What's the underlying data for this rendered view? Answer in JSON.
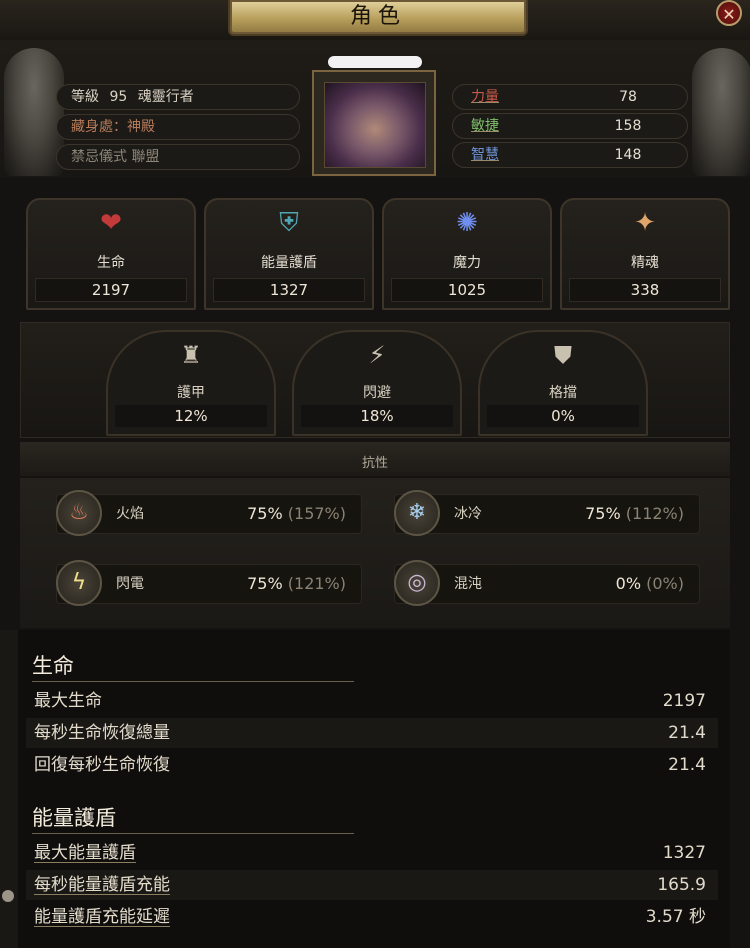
{
  "window": {
    "title": "角色",
    "close_label": "✕"
  },
  "character": {
    "name_redacted": "",
    "level_label": "等級",
    "level": "95",
    "class": "魂靈行者",
    "hideout": "藏身處：神殿",
    "league": "禁忌儀式 聯盟"
  },
  "attributes": [
    {
      "label": "力量",
      "value": "78"
    },
    {
      "label": "敏捷",
      "value": "158"
    },
    {
      "label": "智慧",
      "value": "148"
    }
  ],
  "resources": [
    {
      "label": "生命",
      "value": "2197",
      "icon": "heart-icon"
    },
    {
      "label": "能量護盾",
      "value": "1327",
      "icon": "energy-shield-icon"
    },
    {
      "label": "魔力",
      "value": "1025",
      "icon": "mana-icon"
    },
    {
      "label": "精魂",
      "value": "338",
      "icon": "spirit-icon"
    }
  ],
  "defenses": [
    {
      "label": "護甲",
      "value": "12%",
      "icon": "armour-icon"
    },
    {
      "label": "閃避",
      "value": "18%",
      "icon": "evasion-icon"
    },
    {
      "label": "格擋",
      "value": "0%",
      "icon": "block-shield-icon"
    }
  ],
  "resistances": {
    "title": "抗性",
    "items": [
      {
        "label": "火焰",
        "value": "75%",
        "raw": "(157%)",
        "icon": "fire-icon"
      },
      {
        "label": "冰冷",
        "value": "75%",
        "raw": "(112%)",
        "icon": "cold-icon"
      },
      {
        "label": "閃電",
        "value": "75%",
        "raw": "(121%)",
        "icon": "lightning-icon"
      },
      {
        "label": "混沌",
        "value": "0%",
        "raw": "(0%)",
        "icon": "chaos-icon"
      }
    ]
  },
  "stats": {
    "life": {
      "title": "生命",
      "rows": [
        {
          "label": "最大生命",
          "value": "2197"
        },
        {
          "label": "每秒生命恢復總量",
          "value": "21.4"
        },
        {
          "label": "回復每秒生命恢復",
          "value": "21.4"
        }
      ]
    },
    "energy_shield": {
      "title": "能量護盾",
      "rows": [
        {
          "label": "最大能量護盾",
          "value": "1327"
        },
        {
          "label": "每秒能量護盾充能",
          "value": "165.9"
        },
        {
          "label": "能量護盾充能延遲",
          "value": "3.57 秒"
        }
      ]
    }
  },
  "colors": {
    "gold": "#b89f5c",
    "panel": "#1c1a17",
    "text": "#d9d2c3",
    "close_red": "#8a1e1b"
  }
}
